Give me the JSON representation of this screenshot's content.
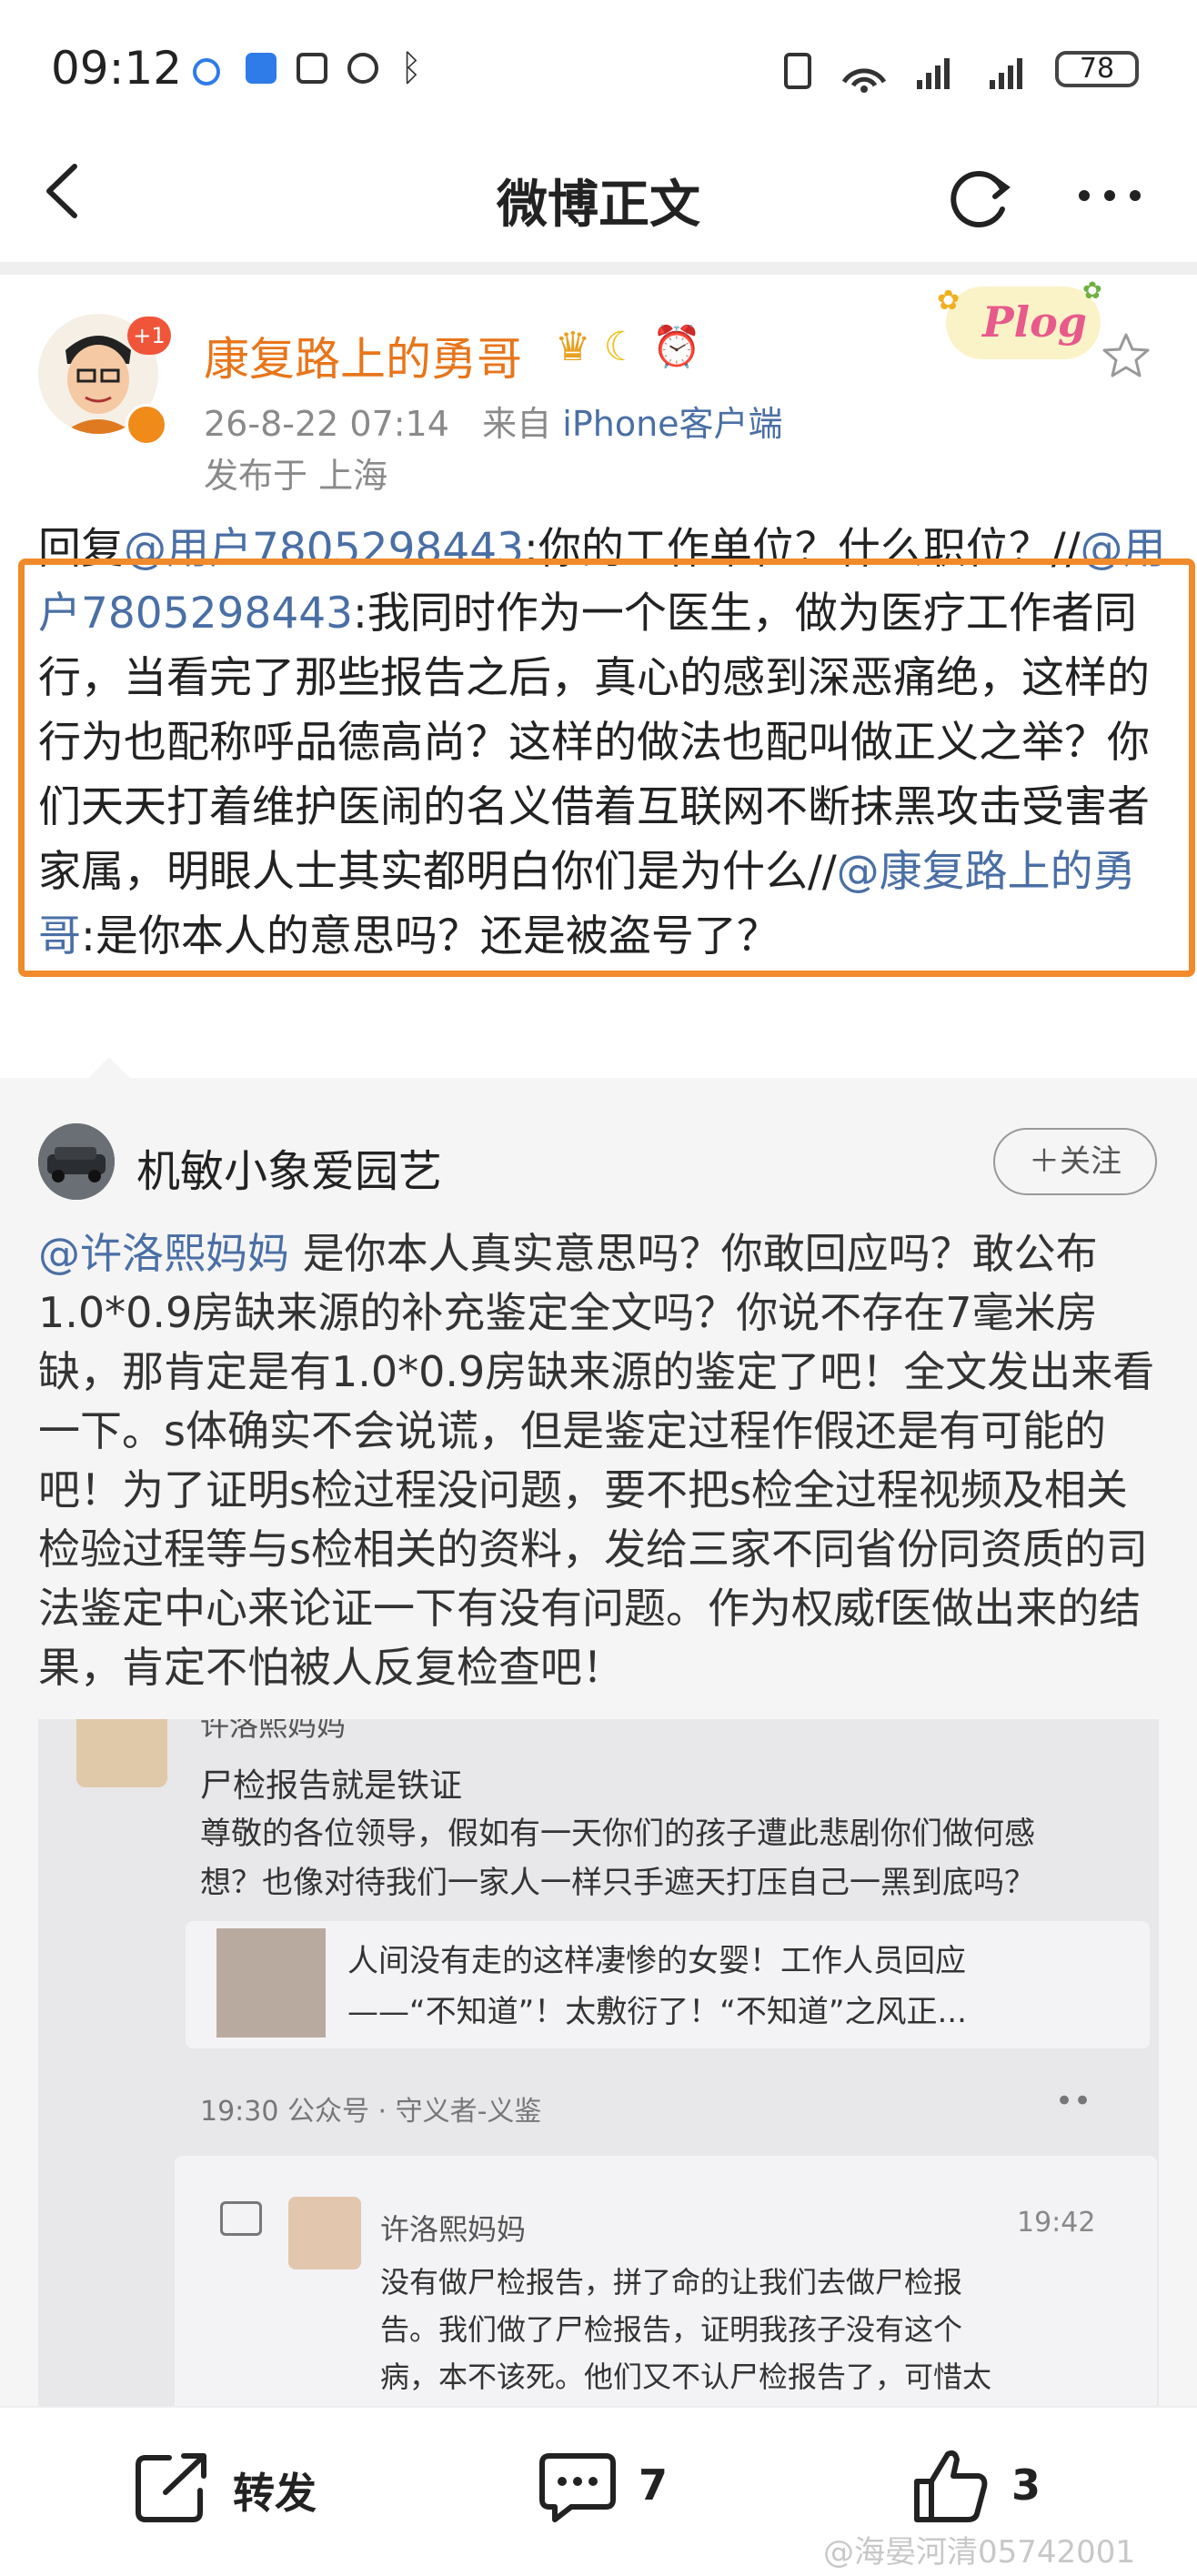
{
  "status_bar": {
    "time": "09:12",
    "battery": "78"
  },
  "nav": {
    "title": "微博正文"
  },
  "author": {
    "name": "康复路上的勇哥",
    "badge": "+1",
    "date": "26-8-22 07:14",
    "source_prefix": "来自",
    "source": "iPhone客户端",
    "location": "发布于 上海",
    "sticker_text": "Plog"
  },
  "post": {
    "p1": "回复",
    "m1": "@用户7805298443",
    "p2": ":你的工作单位？什么职位？//",
    "m2": "@用户7805298443",
    "p3": ":我同时作为一个医生，做为医疗工作者同行，当看完了那些报告之后，真心的感到深恶痛绝，这样的行为也配称呼品德高尚？这样的做法也配叫做正义之举？你们天天打着维护医闹的名义借着互联网不断抹黑攻击受害者家属，明眼人士其实都明白你们是为什么//",
    "m3": "@康复路上的勇哥",
    "p4": ":是你本人的意思吗？还是被盗号了？"
  },
  "quote": {
    "name": "机敏小象爱园艺",
    "follow_label": "＋关注",
    "mention": "@许洛熙妈妈",
    "text": " 是你本人真实意思吗？你敢回应吗？敢公布1.0*0.9房缺来源的补充鉴定全文吗？你说不存在7毫米房缺，那肯定是有1.0*0.9房缺来源的鉴定了吧！全文发出来看一下。s体确实不会说谎，但是鉴定过程作假还是有可能的吧！为了证明s检过程没问题，要不把s检全过程视频及相关检验过程等与s检相关的资料，发给三家不同省份同资质的司法鉴定中心来论证一下有没有问题。作为权威f医做出来的结果，肯定不怕被人反复检查吧！"
  },
  "image": {
    "top_name": "许洛熙妈妈",
    "line1": "尸检报告就是铁证",
    "line2": "尊敬的各位领导，假如有一天你们的孩子遭此悲剧你们做何感",
    "line3": "想？也像对待我们一家人一样只手遮天打压自己一黑到底吗？",
    "article_title": "人间没有走的这样凄惨的女婴！工作人员回应",
    "article_sub": "——“不知道”！太敷衍了！“不知道”之风正...",
    "article_meta": "19:30 公众号 · 守义者-义鉴",
    "more": "••",
    "comment_name": "许洛熙妈妈",
    "comment_time": "19:42",
    "c1": "没有做尸检报告，拼了命的让我们去做尸检报",
    "c2": "告。我们做了尸检报告，证明我孩子没有这个",
    "c3": "病，本不该死。他们又不认尸检报告了，可惜太"
  },
  "bottom": {
    "repost_label": "转发",
    "comment_count": "7",
    "like_count": "3"
  },
  "watermark": "@海晏河清05742001"
}
